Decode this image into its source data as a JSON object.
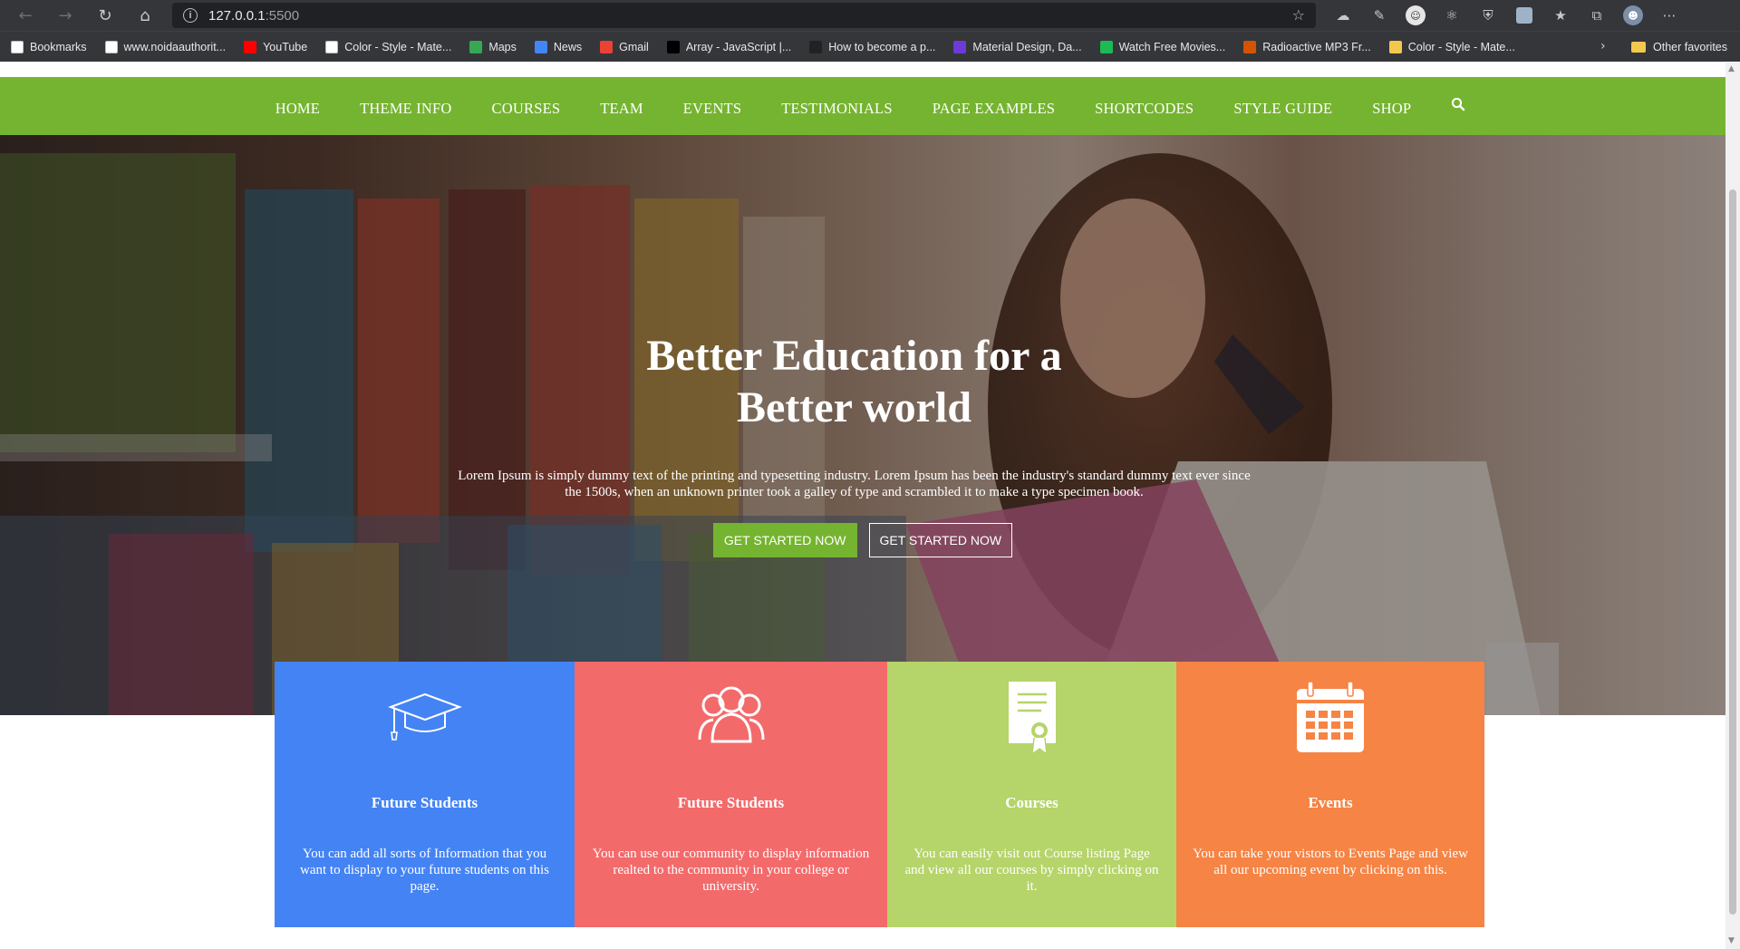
{
  "browser": {
    "url_host": "127.0.0.1",
    "url_port": ":5500",
    "bookmarks": [
      {
        "label": "Bookmarks",
        "icon": "page-icon",
        "color": "#ffffff"
      },
      {
        "label": "www.noidaauthorit...",
        "icon": "page-icon",
        "color": "#ffffff"
      },
      {
        "label": "YouTube",
        "icon": "youtube-icon",
        "color": "#ff0000"
      },
      {
        "label": "Color - Style - Mate...",
        "icon": "page-icon",
        "color": "#ffffff"
      },
      {
        "label": "Maps",
        "icon": "maps-icon",
        "color": "#34a853"
      },
      {
        "label": "News",
        "icon": "news-icon",
        "color": "#4285f4"
      },
      {
        "label": "Gmail",
        "icon": "gmail-icon",
        "color": "#ea4335"
      },
      {
        "label": "Array - JavaScript |...",
        "icon": "mdn-icon",
        "color": "#000000"
      },
      {
        "label": "How to become a p...",
        "icon": "page-icon",
        "color": "#222222"
      },
      {
        "label": "Material Design, Da...",
        "icon": "material-icon",
        "color": "#6b3bd6"
      },
      {
        "label": "Watch Free Movies...",
        "icon": "movie-icon",
        "color": "#1db954"
      },
      {
        "label": "Radioactive MP3 Fr...",
        "icon": "music-icon",
        "color": "#d35400"
      },
      {
        "label": "Color - Style - Mate...",
        "icon": "flag-icon",
        "color": "#f2c94c"
      }
    ],
    "other_favorites": "Other favorites"
  },
  "nav": {
    "items": [
      "HOME",
      "THEME INFO",
      "COURSES",
      "TEAM",
      "EVENTS",
      "TESTIMONIALS",
      "PAGE EXAMPLES",
      "SHORTCODES",
      "STYLE GUIDE",
      "SHOP"
    ],
    "search_icon": "search-icon"
  },
  "hero": {
    "title_line1": "Better Education for a",
    "title_line2": "Better world",
    "text_line1": "Lorem Ipsum is simply dummy text of the printing and typesetting industry. Lorem Ipsum has been the industry's standard dummy text ever since",
    "text_line2": "the 1500s, when an unknown printer took a galley of type and scrambled it to make a type specimen book.",
    "btn_primary": "GET STARTED NOW",
    "btn_secondary": "GET STARTED NOW"
  },
  "features": [
    {
      "title": "Future Students",
      "icon": "graduation-cap-icon",
      "color": "#4483f4",
      "text": "You can add all sorts of Information that you want to display to your future students on this page."
    },
    {
      "title": "Future Students",
      "icon": "community-icon",
      "color": "#f36a6b",
      "text": "You can use our community to display information realted to the community in your college or university."
    },
    {
      "title": "Courses",
      "icon": "certificate-icon",
      "color": "#b5d46a",
      "text": "You can easily visit out Course listing Page and view all our courses by simply clicking on it."
    },
    {
      "title": "Events",
      "icon": "calendar-icon",
      "color": "#f58445",
      "text": "You can take your vistors to Events Page and view all our upcoming event by clicking on this."
    }
  ],
  "colors": {
    "nav_green": "#75b430",
    "chrome_dark": "#35363a"
  }
}
